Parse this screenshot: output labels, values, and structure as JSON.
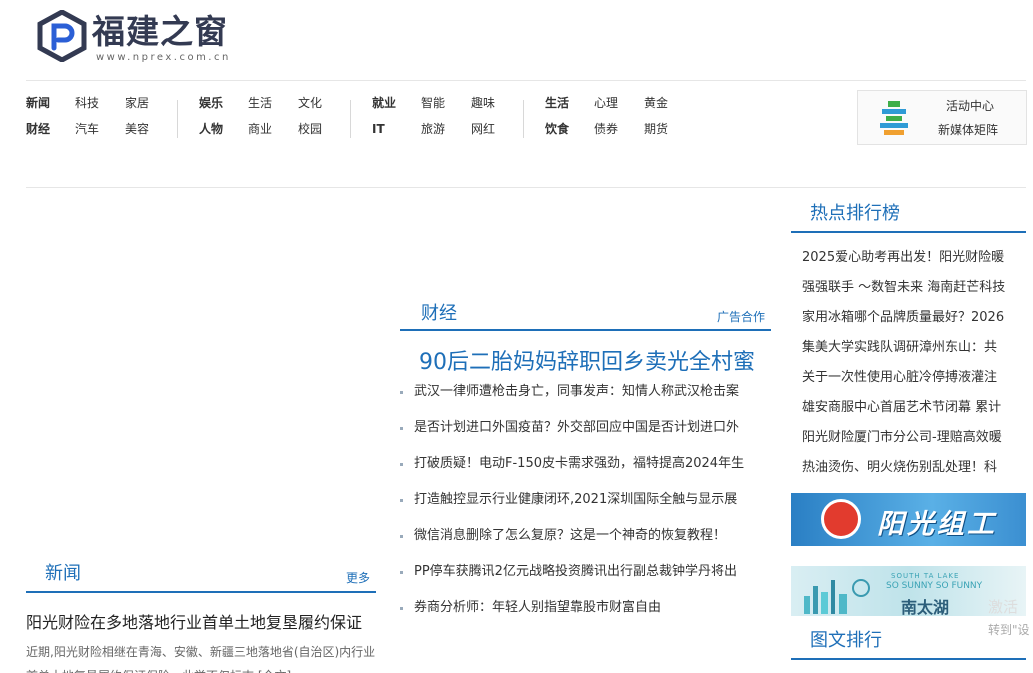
{
  "logo": {
    "name": "福建之窗",
    "url": "www.nprex.com.cn"
  },
  "nav": {
    "groups": [
      {
        "rows": [
          [
            "新闻",
            "科技",
            "家居"
          ],
          [
            "财经",
            "汽车",
            "美容"
          ]
        ]
      },
      {
        "rows": [
          [
            "娱乐",
            "生活",
            "文化"
          ],
          [
            "人物",
            "商业",
            "校园"
          ]
        ]
      },
      {
        "rows": [
          [
            "就业",
            "智能",
            "趣味"
          ],
          [
            "IT",
            "旅游",
            "网红"
          ]
        ]
      },
      {
        "rows": [
          [
            "生活",
            "心理",
            "黄金"
          ],
          [
            "饮食",
            "债券",
            "期货"
          ]
        ]
      }
    ]
  },
  "activity": {
    "line1": "活动中心",
    "line2": "新媒体矩阵"
  },
  "finance": {
    "title": "财经",
    "ad": "广告合作",
    "headline": "90后二胎妈妈辞职回乡卖光全村蜜",
    "items": [
      "武汉一律师遭枪击身亡，同事发声：知情人称武汉枪击案",
      "是否计划进口外国疫苗？外交部回应中国是否计划进口外",
      "打破质疑！电动F-150皮卡需求强劲，福特提高2024年生",
      "打造触控显示行业健康闭环,2021深圳国际全触与显示展",
      "微信消息删除了怎么复原？这是一个神奇的恢复教程！",
      "PP停车获腾讯2亿元战略投资腾讯出行副总裁钟学丹将出",
      "券商分析师：年轻人别指望靠股市财富自由"
    ]
  },
  "hot": {
    "title": "热点排行榜",
    "items": [
      "2025爱心助考再出发！阳光财险暖",
      "强强联手 ～数智未来 海南赶芒科技",
      "家用冰箱哪个品牌质量最好？2026",
      "集美大学实践队调研漳州东山：共",
      "关于一次性使用心脏冷停搏液灌注",
      "雄安商服中心首届艺术节闭幕 累计",
      "阳光财险厦门市分公司-理赔高效暖",
      "热油烫伤、明火烧伤别乱处理！科"
    ]
  },
  "banner1": {
    "text": "阳光组工"
  },
  "banner2": {
    "line1": "SOUTH TA LAKE",
    "line2": "SO SUNNY SO FUNNY",
    "line3": "南太湖"
  },
  "pics": {
    "title": "图文排行"
  },
  "news": {
    "title": "新闻",
    "more": "更多",
    "lead_title": "阳光财险在多地落地行业首单土地复垦履约保证",
    "lead_body": "近期,阳光财险相继在青海、安徽、新疆三地落地省(自治区)内行业首单土地复垦履约保证保险，此举不仅标志 [全文]"
  },
  "watermark": {
    "line1": "激活",
    "line2": "转到\"设"
  },
  "colors": {
    "accent": "#1e6fb8",
    "logo": "#333a52"
  }
}
